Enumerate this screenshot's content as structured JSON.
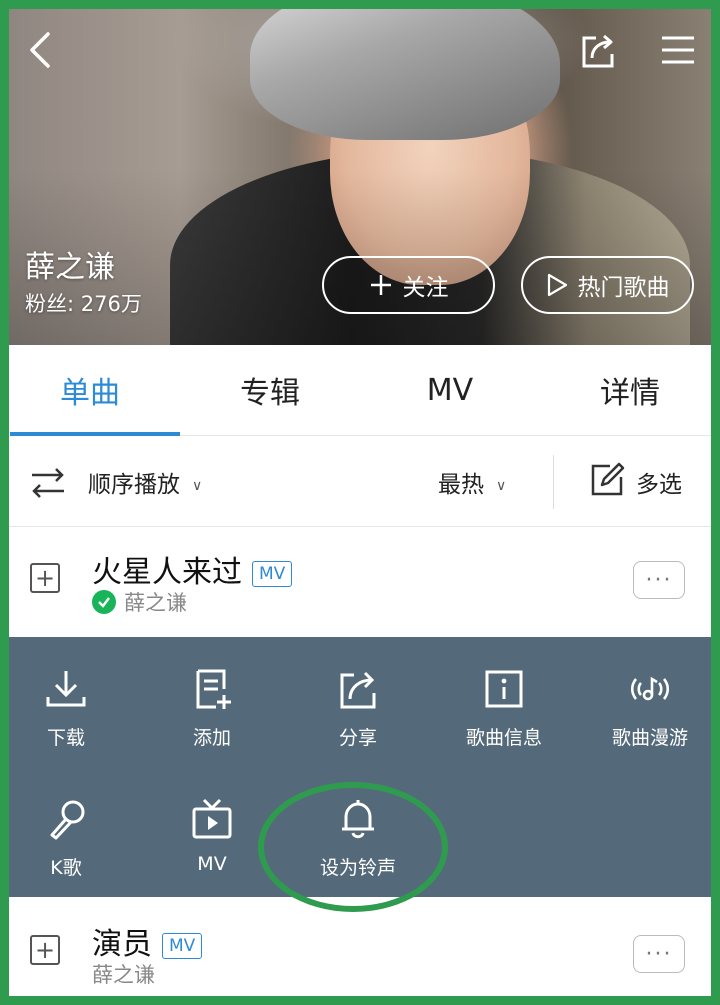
{
  "header": {
    "artist_name": "薛之谦",
    "fans": "粉丝: 276万",
    "follow_label": "关注",
    "hot_songs_label": "热门歌曲"
  },
  "tabs": [
    "单曲",
    "专辑",
    "MV",
    "详情"
  ],
  "toolbar": {
    "play_order": "顺序播放",
    "sort": "最热",
    "multi_select": "多选"
  },
  "songs": [
    {
      "title": "火星人来过",
      "badge": "MV",
      "artist": "薛之谦"
    },
    {
      "title": "演员",
      "badge": "MV",
      "artist": "薛之谦"
    }
  ],
  "actions": [
    {
      "label": "下载",
      "icon": "download-icon"
    },
    {
      "label": "添加",
      "icon": "add-to-playlist-icon"
    },
    {
      "label": "分享",
      "icon": "share-icon"
    },
    {
      "label": "歌曲信息",
      "icon": "info-icon"
    },
    {
      "label": "歌曲漫游",
      "icon": "music-roam-icon"
    },
    {
      "label": "K歌",
      "icon": "microphone-icon"
    },
    {
      "label": "MV",
      "icon": "tv-icon"
    },
    {
      "label": "设为铃声",
      "icon": "bell-icon"
    }
  ],
  "colors": {
    "accent": "#2d8bd6",
    "panel": "#546a7a",
    "highlight": "#2f9b4f",
    "verified": "#19b45a"
  }
}
